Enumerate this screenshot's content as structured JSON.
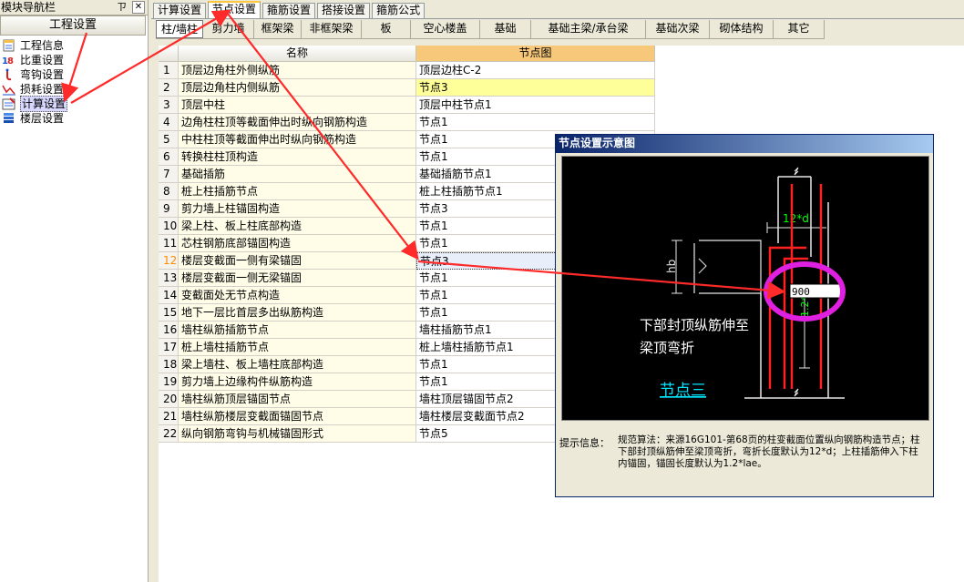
{
  "nav": {
    "title": "模块导航栏",
    "pin_glyph": "ㄗ",
    "close_glyph": "✕",
    "group_label": "工程设置",
    "items": [
      {
        "label": "工程信息",
        "icon": "info-sheet-icon"
      },
      {
        "label": "比重设置",
        "icon": "weight-icon"
      },
      {
        "label": "弯钩设置",
        "icon": "hook-icon"
      },
      {
        "label": "损耗设置",
        "icon": "loss-chart-icon"
      },
      {
        "label": "计算设置",
        "icon": "calc-settings-icon",
        "selected": true
      },
      {
        "label": "楼层设置",
        "icon": "floor-stack-icon"
      }
    ]
  },
  "top_tabs": [
    {
      "label": "计算设置",
      "active": false
    },
    {
      "label": "节点设置",
      "active": true
    },
    {
      "label": "箍筋设置",
      "active": false
    },
    {
      "label": "搭接设置",
      "active": false
    },
    {
      "label": "箍筋公式",
      "active": false
    }
  ],
  "sub_tabs": [
    {
      "label": "柱/墙柱",
      "active": true
    },
    {
      "label": "剪力墙",
      "active": false
    },
    {
      "label": "框架梁",
      "active": false
    },
    {
      "label": "非框架梁",
      "active": false
    },
    {
      "label": "板",
      "active": false
    },
    {
      "label": "空心楼盖",
      "active": false
    },
    {
      "label": "基础",
      "active": false
    },
    {
      "label": "基础主梁/承台梁",
      "active": false
    },
    {
      "label": "基础次梁",
      "active": false
    },
    {
      "label": "砌体结构",
      "active": false
    },
    {
      "label": "其它",
      "active": false
    }
  ],
  "grid": {
    "columns": [
      "名称",
      "节点图"
    ],
    "rows": [
      {
        "n": "1",
        "name": "顶层边角柱外侧纵筋",
        "value": "顶层边柱C-2"
      },
      {
        "n": "2",
        "name": "顶层边角柱内侧纵筋",
        "value": "节点3",
        "highlight": true
      },
      {
        "n": "3",
        "name": "顶层中柱",
        "value": "顶层中柱节点1"
      },
      {
        "n": "4",
        "name": "边角柱柱顶等截面伸出时纵向钢筋构造",
        "value": "节点1"
      },
      {
        "n": "5",
        "name": "中柱柱顶等截面伸出时纵向钢筋构造",
        "value": "节点1"
      },
      {
        "n": "6",
        "name": "转换柱柱顶构造",
        "value": "节点1"
      },
      {
        "n": "7",
        "name": "基础插筋",
        "value": "基础插筋节点1"
      },
      {
        "n": "8",
        "name": "桩上柱插筋节点",
        "value": "桩上柱插筋节点1"
      },
      {
        "n": "9",
        "name": "剪力墙上柱锚固构造",
        "value": "节点3"
      },
      {
        "n": "10",
        "name": "梁上柱、板上柱底部构造",
        "value": "节点1"
      },
      {
        "n": "11",
        "name": "芯柱钢筋底部锚固构造",
        "value": "节点1"
      },
      {
        "n": "12",
        "name": "楼层变截面一侧有梁锚固",
        "value": "节点3",
        "selected": true
      },
      {
        "n": "13",
        "name": "楼层变截面一侧无梁锚固",
        "value": "节点1"
      },
      {
        "n": "14",
        "name": "变截面处无节点构造",
        "value": "节点1"
      },
      {
        "n": "15",
        "name": "地下一层比首层多出纵筋构造",
        "value": "节点1"
      },
      {
        "n": "16",
        "name": "墙柱纵筋插筋节点",
        "value": "墙柱插筋节点1"
      },
      {
        "n": "17",
        "name": "桩上墙柱插筋节点",
        "value": "桩上墙柱插筋节点1"
      },
      {
        "n": "18",
        "name": "梁上墙柱、板上墙柱底部构造",
        "value": "节点1"
      },
      {
        "n": "19",
        "name": "剪力墙上边缘构件纵筋构造",
        "value": "节点1"
      },
      {
        "n": "20",
        "name": "墙柱纵筋顶层锚固节点",
        "value": "墙柱顶层锚固节点2"
      },
      {
        "n": "21",
        "name": "墙柱纵筋楼层变截面锚固节点",
        "value": "墙柱楼层变截面节点2"
      },
      {
        "n": "22",
        "name": "纵向钢筋弯钩与机械锚固形式",
        "value": "节点5"
      }
    ]
  },
  "dialog": {
    "title": "节点设置示意图",
    "drawing": {
      "dim_top": "12*d",
      "dim_left": "hb",
      "dim_right": "1.2*la",
      "value_box": "900",
      "description_line1": "下部封顶纵筋伸至",
      "description_line2": "梁顶弯折",
      "node_label": "节点三"
    },
    "hint_label": "提示信息：",
    "hint_text": "规范算法：来源16G101-第68页的柱变截面位置纵向钢筋构造节点；柱下部封顶纵筋伸至梁顶弯折，弯折长度默认为12*d；上柱插筋伸入下柱内锚固，锚固长度默认为1.2*lae。"
  },
  "colors": {
    "annotation_arrow": "#ff2a2a",
    "highlight_circle": "#e020e0",
    "rebar": "#ff2020",
    "dimension_text": "#00ff00",
    "node_label": "#00e5ff"
  }
}
